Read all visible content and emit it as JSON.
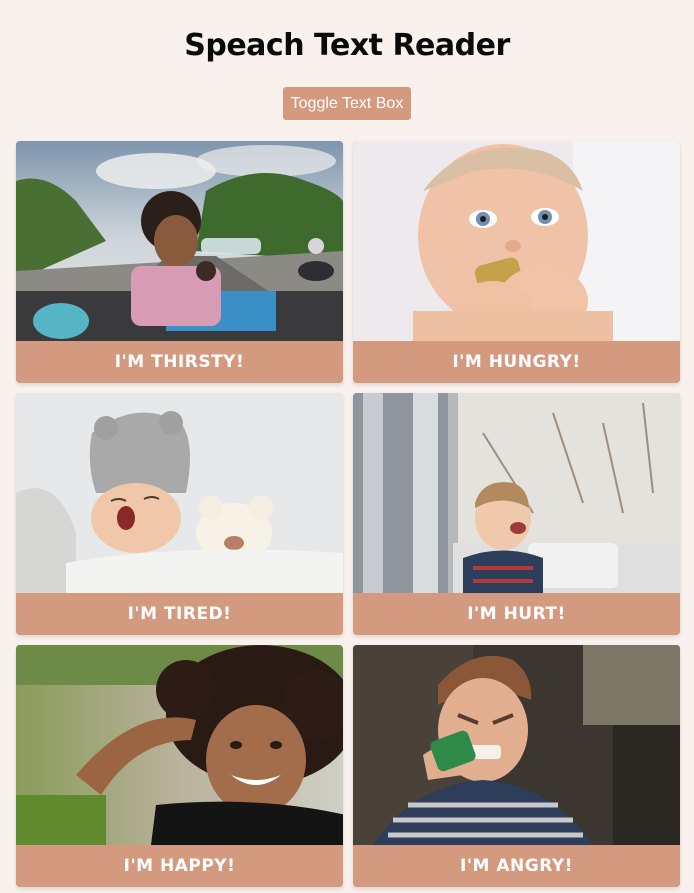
{
  "page": {
    "title": "Speach Text Reader",
    "toggle_label": "Toggle Text Box"
  },
  "cards": [
    {
      "caption": "I'M THIRSTY!",
      "photo": "thirsty-boy-photo"
    },
    {
      "caption": "I'M HUNGRY!",
      "photo": "hungry-baby-photo"
    },
    {
      "caption": "I'M TIRED!",
      "photo": "tired-baby-photo"
    },
    {
      "caption": "I'M HURT!",
      "photo": "hurt-toddler-photo"
    },
    {
      "caption": "I'M HAPPY!",
      "photo": "happy-girl-photo"
    },
    {
      "caption": "I'M ANGRY!",
      "photo": "angry-boy-photo"
    }
  ],
  "colors": {
    "background": "#f9f1ee",
    "accent": "#d49a80",
    "caption_text": "#ffffff",
    "title_text": "#0a0a0a"
  }
}
